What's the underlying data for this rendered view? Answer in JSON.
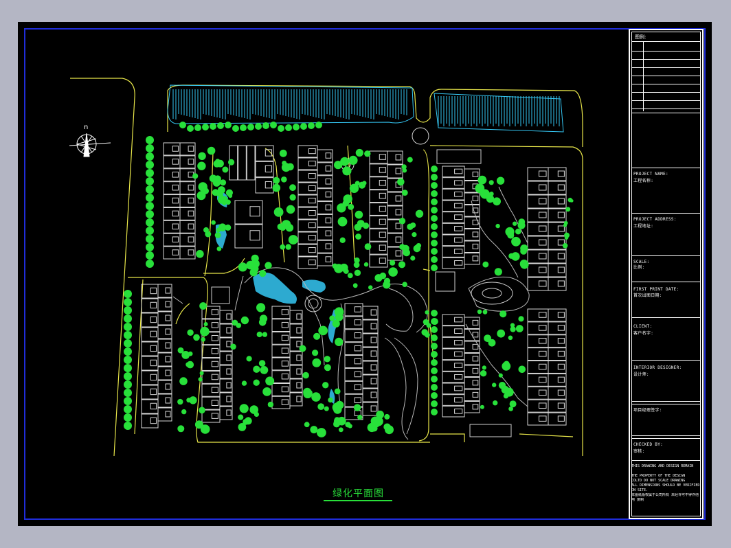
{
  "drawing": {
    "title": "绿化平面图"
  },
  "title_block": {
    "legend_label": "图例:",
    "project_name_en": "PROJECT NAME:",
    "project_name_cn": "工程名称:",
    "project_address_en": "PROJECT ADDRESS:",
    "project_address_cn": "工程地址:",
    "scale_en": "SCALE:",
    "scale_cn": "比例:",
    "first_print_en": "FIRST PRINT DATE:",
    "first_print_cn": "首次出图日期:",
    "client_en": "CLIENT:",
    "client_cn": "客户名字:",
    "designer_en": "INTERIOR DESIGNER:",
    "designer_cn": "设计师:",
    "manager_cn": "项目经理签字:",
    "checked_en": "CHECKED BY:",
    "checked_cn": "审核:",
    "note_lines": [
      "THIS DRAWING AND DESIGN REMAIN",
      "THE PROPERTY OF THE DESIGN",
      "COLTD DO NOT SCALE DRAWING",
      "ALL DIMENSIONS SHOULD BE VERIFIED",
      "ON SITE.",
      "本图纸版权属于公司所有 未经许可不得作他",
      "用 复制"
    ]
  },
  "colors": {
    "background": "#000000",
    "frame": "#1f2dd8",
    "trees": "#28e03a",
    "buildings": "#ffffff",
    "roads": "#e8e64a",
    "water": "#35c8f5"
  }
}
